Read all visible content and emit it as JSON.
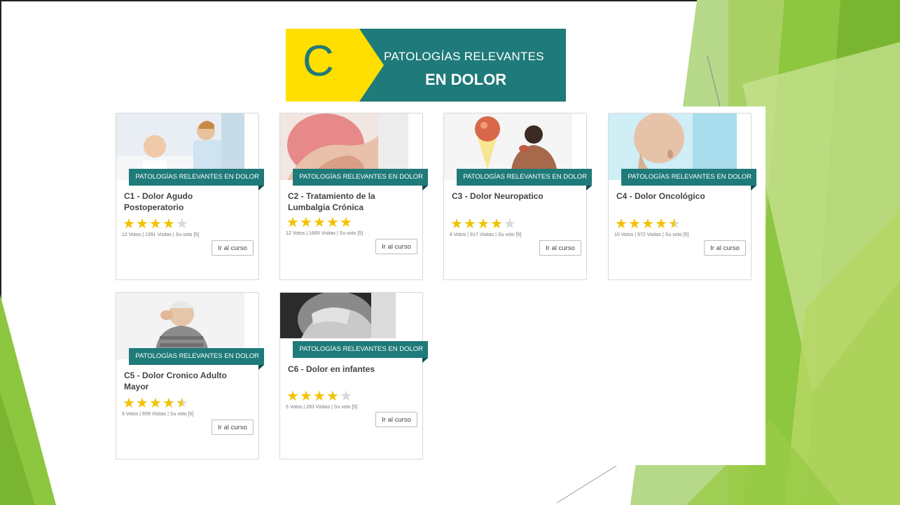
{
  "banner": {
    "letter": "C",
    "line1": "PATOLOGÍAS RELEVANTES",
    "line2": "EN DOLOR"
  },
  "colors": {
    "teal": "#1f7a7a",
    "yellow": "#ffdf00",
    "green": "#8dc63f",
    "star": "#f2c200"
  },
  "courses": [
    {
      "tag": "PATOLOGÍAS RELEVANTES EN DOLOR",
      "title": "C1 - Dolor Agudo Postoperatorio",
      "rating": 4,
      "stats": "12 Votos | 1391 Visitas | Su voto [5]",
      "button": "Ir al curso"
    },
    {
      "tag": "PATOLOGÍAS RELEVANTES EN DOLOR",
      "title": "C2 - Tratamiento de la Lumbalgia Crónica",
      "rating": 5,
      "stats": "12 Votos | 1669 Visitas | Su voto [5]",
      "button": "Ir al curso"
    },
    {
      "tag": "PATOLOGÍAS RELEVANTES EN DOLOR",
      "title": "C3 - Dolor Neuropatico",
      "rating": 4,
      "stats": "8 Votos | 917 Visitas | Su voto [5]",
      "button": "Ir al curso"
    },
    {
      "tag": "PATOLOGÍAS RELEVANTES EN DOLOR",
      "title": "C4 - Dolor Oncológico",
      "rating": 4.5,
      "stats": "10 Votos | 972 Visitas | Su voto [5]",
      "button": "Ir al curso"
    },
    {
      "tag": "PATOLOGÍAS RELEVANTES EN DOLOR",
      "title": "C5 - Dolor Cronico Adulto Mayor",
      "rating": 4.5,
      "stats": "5 Votos | 659 Visitas | Su voto [5]",
      "button": "Ir al curso"
    },
    {
      "tag": "PATOLOGÍAS RELEVANTES EN DOLOR",
      "title": "C6 - Dolor en infantes",
      "rating": 4,
      "stats": "5 Votos | 283 Visitas | Su voto [5]",
      "button": "Ir al curso"
    }
  ]
}
